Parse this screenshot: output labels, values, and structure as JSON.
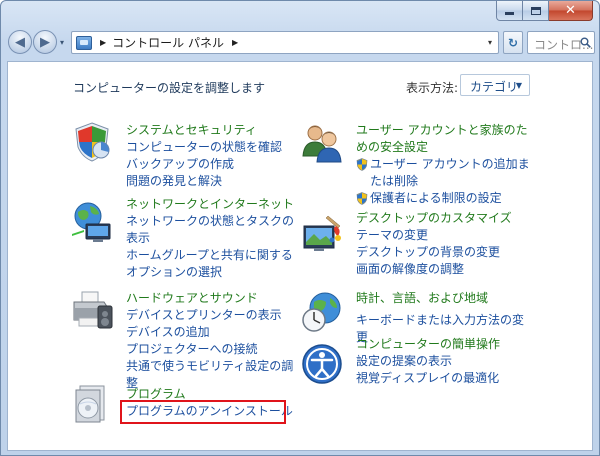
{
  "window": {
    "close_glyph": "✕"
  },
  "nav": {
    "back_glyph": "◀",
    "forward_glyph": "▶",
    "history_glyph": "▾",
    "address": {
      "separator": "▶",
      "crumb": "コントロール パネル",
      "trailing_separator": "▶",
      "dropdown_glyph": "▾"
    },
    "refresh_glyph": "↻",
    "search": {
      "placeholder": "コントロ...",
      "icon": "search-icon"
    }
  },
  "content": {
    "title": "コンピューターの設定を調整します",
    "view_by": {
      "label": "表示方法:",
      "value": "カテゴリ",
      "dropdown_glyph": "▼"
    }
  },
  "categories": {
    "system": {
      "title": "システムとセキュリティ",
      "icon": "shield-icon",
      "links": [
        "コンピューターの状態を確認",
        "バックアップの作成",
        "問題の発見と解決"
      ]
    },
    "network": {
      "title": "ネットワークとインターネット",
      "icon": "network-globe-icon",
      "links": [
        "ネットワークの状態とタスクの表示",
        "ホームグループと共有に関するオプションの選択"
      ]
    },
    "hardware": {
      "title": "ハードウェアとサウンド",
      "icon": "printer-icon",
      "links": [
        "デバイスとプリンターの表示",
        "デバイスの追加",
        "プロジェクターへの接続",
        "共通で使うモビリティ設定の調整"
      ]
    },
    "programs": {
      "title": "プログラム",
      "icon": "programs-icon",
      "links": [
        "プログラムのアンインストール"
      ]
    },
    "users": {
      "title": "ユーザー アカウントと家族のための安全設定",
      "icon": "users-icon",
      "links": [
        "ユーザー アカウントの追加または削除",
        "保護者による制限の設定"
      ]
    },
    "appearance": {
      "title": "デスクトップのカスタマイズ",
      "icon": "paint-icon",
      "links": [
        "テーマの変更",
        "デスクトップの背景の変更",
        "画面の解像度の調整"
      ]
    },
    "clock": {
      "title": "時計、言語、および地域",
      "icon": "clock-globe-icon",
      "links": [
        "キーボードまたは入力方法の変更"
      ]
    },
    "ease": {
      "title": "コンピューターの簡単操作",
      "icon": "ease-of-access-icon",
      "links": [
        "設定の提案の表示",
        "視覚ディスプレイの最適化"
      ]
    }
  },
  "colors": {
    "category_title": "#217a1c",
    "link": "#1c4f9e",
    "highlight_border": "#e0141b"
  }
}
